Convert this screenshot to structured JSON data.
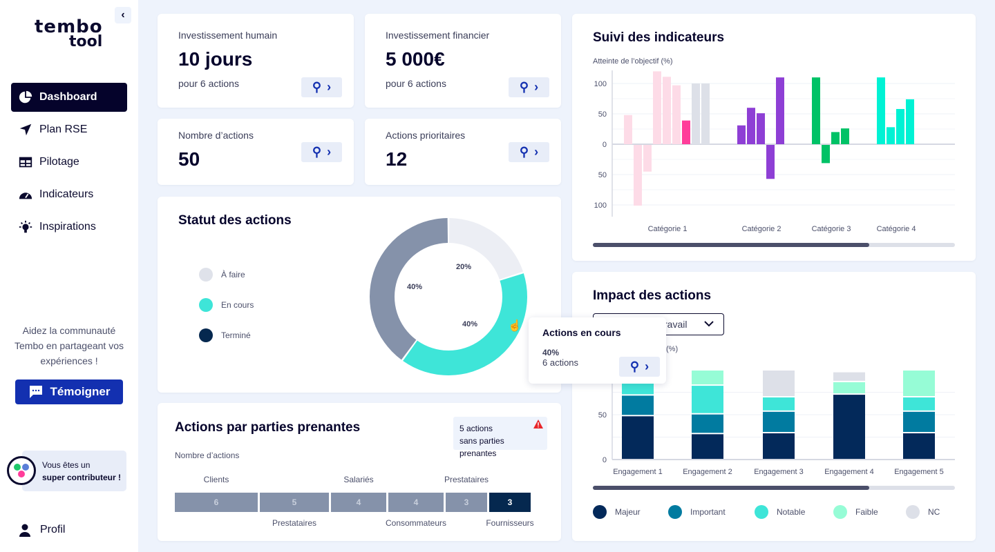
{
  "sidebar": {
    "logo_line1": "tembo",
    "logo_line2": "tool",
    "items": [
      {
        "label": "Dashboard",
        "icon": "pie-chart-icon"
      },
      {
        "label": "Plan RSE",
        "icon": "navigation-arrow-icon"
      },
      {
        "label": "Pilotage",
        "icon": "table-icon"
      },
      {
        "label": "Indicateurs",
        "icon": "gauge-icon"
      },
      {
        "label": "Inspirations",
        "icon": "lightbulb-icon"
      }
    ],
    "help_text": "Aidez la communauté Tembo en partageant vos expériences !",
    "testimony_button": "Témoigner",
    "badge_line1": "Vous êtes un",
    "badge_line2": "super contributeur !",
    "profile": "Profil"
  },
  "kpis": [
    {
      "label": "Investissement humain",
      "value": "10 jours",
      "sub": "pour 6 actions"
    },
    {
      "label": "Investissement financier",
      "value": "5 000€",
      "sub": "pour 6 actions"
    },
    {
      "label": "Nombre d’actions",
      "value": "50"
    },
    {
      "label": "Actions prioritaires",
      "value": "12"
    }
  ],
  "status": {
    "title": "Statut des actions",
    "legend": [
      {
        "label": "À faire",
        "color": "#dfe2ea"
      },
      {
        "label": "En cours",
        "color": "#3ee5d8"
      },
      {
        "label": "Terminé",
        "color": "#05284f"
      }
    ],
    "chart_data": {
      "type": "pie",
      "slices": [
        {
          "label": "À faire",
          "value": 20,
          "color": "#eceef4"
        },
        {
          "label": "En cours",
          "value": 40,
          "color": "#3ee5d8"
        },
        {
          "label": "Terminé",
          "value": 40,
          "color": "#8592aa"
        }
      ],
      "labels": [
        "20%",
        "40%",
        "40%"
      ]
    },
    "tooltip": {
      "title": "Actions en cours",
      "percent": "40%",
      "count": "6 actions"
    }
  },
  "stakeholders": {
    "title": "Actions par parties prenantes",
    "ylabel": "Nombre d’actions",
    "warning_line1": "5 actions",
    "warning_line2": "sans parties prenantes",
    "chart_data": {
      "type": "bar",
      "categories": [
        "Clients",
        "Prestataires",
        "Salariés",
        "Consommateurs",
        "Prestataires",
        "Fournisseurs"
      ],
      "values": [
        6,
        5,
        4,
        4,
        3,
        3
      ]
    }
  },
  "indicators": {
    "title": "Suivi des indicateurs",
    "chart_data": {
      "type": "bar",
      "ylabel": "Atteinte de l’objectif (%)",
      "yticks": [
        "100",
        "50",
        "0",
        "50",
        "100"
      ],
      "ylim": [
        -100,
        120
      ],
      "categories": [
        "Catégorie 1",
        "Catégorie 2",
        "Catégorie 3",
        "Catégorie 4"
      ],
      "series": [
        {
          "category": "Catégorie 1",
          "values": [
            48,
            -100,
            -44,
            120,
            111,
            97,
            39,
            100,
            100
          ],
          "colors": [
            "#fddbe7",
            "#fddbe7",
            "#fddbe7",
            "#fddbe7",
            "#fddbe7",
            "#fddbe7",
            "#ff3d9a",
            "#dde0e8",
            "#dde0e8"
          ]
        },
        {
          "category": "Catégorie 2",
          "values": [
            31,
            60,
            51,
            -56,
            110
          ],
          "color": "#8e3fd5"
        },
        {
          "category": "Catégorie 3",
          "values": [
            110,
            -30,
            20,
            26
          ],
          "color": "#00c266"
        },
        {
          "category": "Catégorie 4",
          "values": [
            110,
            28,
            58,
            74
          ],
          "color": "#00f2d4"
        }
      ]
    }
  },
  "impact": {
    "title": "Impact des actions",
    "dropdown_value": "ravail",
    "ylabel": "(%)",
    "chart_data": {
      "type": "bar",
      "stacked": true,
      "yticks": [
        "0",
        "50"
      ],
      "categories": [
        "Engagement 1",
        "Engagement 2",
        "Engagement 3",
        "Engagement 4",
        "Engagement 5"
      ],
      "series": [
        {
          "name": "Majeur",
          "color": "#03295a",
          "values": [
            49,
            29,
            30,
            73,
            30
          ]
        },
        {
          "name": "Important",
          "color": "#017ba0",
          "values": [
            23,
            22,
            24,
            0,
            24
          ]
        },
        {
          "name": "Notable",
          "color": "#3ee5d8",
          "values": [
            28,
            32,
            16,
            0,
            16
          ]
        },
        {
          "name": "Faible",
          "color": "#96fcd6",
          "values": [
            0,
            17,
            0,
            14,
            30
          ]
        },
        {
          "name": "NC",
          "color": "#dde0e8",
          "values": [
            0,
            0,
            30,
            11,
            0
          ]
        }
      ]
    }
  }
}
